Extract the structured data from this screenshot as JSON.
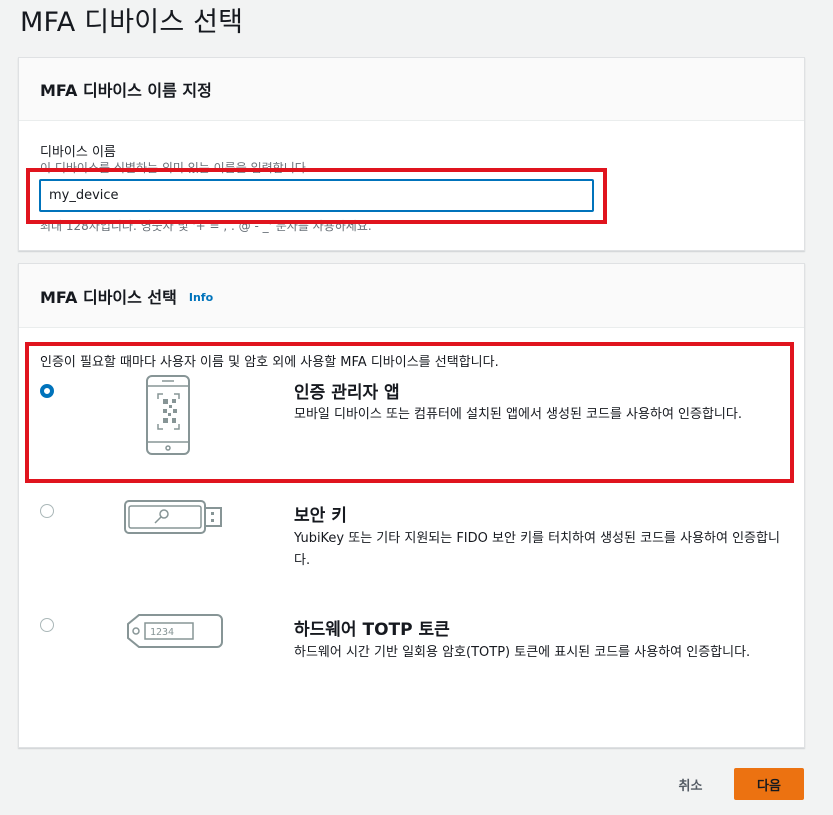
{
  "page": {
    "title": "MFA 디바이스 선택"
  },
  "name_panel": {
    "title": "MFA 디바이스 이름 지정",
    "label": "디바이스 이름",
    "description": "이 디바이스를 식별하는 의미 있는 이름을 입력합니다.",
    "value": "my_device",
    "constraint": "최대 128자입니다. 영숫자 및 '+ = , . @ - _' 문자를 사용하세요."
  },
  "device_panel": {
    "title": "MFA 디바이스 선택",
    "info": "Info",
    "description": "인증이 필요할 때마다 사용자 이름 및 암호 외에 사용할 MFA 디바이스를 선택합니다.",
    "options": [
      {
        "title": "인증 관리자 앱",
        "description": "모바일 디바이스 또는 컴퓨터에 설치된 앱에서 생성된 코드를 사용하여 인증합니다.",
        "selected": true,
        "icon": "phone-qr-icon"
      },
      {
        "title": "보안 키",
        "description": "YubiKey 또는 기타 지원되는 FIDO 보안 키를 터치하여 생성된 코드를 사용하여 인증합니다.",
        "selected": false,
        "icon": "security-key-icon"
      },
      {
        "title": "하드웨어 TOTP 토큰",
        "description": "하드웨어 시간 기반 일회용 암호(TOTP) 토큰에 표시된 코드를 사용하여 인증합니다.",
        "selected": false,
        "icon": "totp-token-icon",
        "token_display": "1234"
      }
    ]
  },
  "footer": {
    "cancel": "취소",
    "next": "다음"
  },
  "colors": {
    "accent": "#0073bb",
    "primary_button": "#ec7211",
    "highlight": "#e0141e"
  }
}
